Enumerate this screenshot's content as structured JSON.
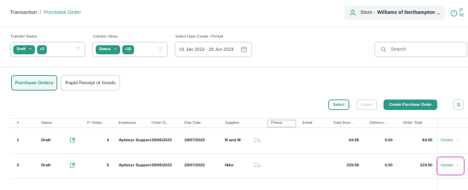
{
  "breadcrumb": {
    "root": "Transaction",
    "separator": "/",
    "current": "Purchase Order"
  },
  "store": {
    "prefix": "Store -",
    "name": "Williams of Northampton"
  },
  "help": {
    "label": "P M"
  },
  "filters": {
    "transfer_status": {
      "label": "Transfer Status",
      "chip": "Draft",
      "more": "+3"
    },
    "column_views": {
      "label": "Column Views",
      "chip": "Status",
      "more": "+10"
    },
    "date": {
      "label": "Select Date Create / Period",
      "value": "01 Jan 2023 - 29 Jun 2023"
    }
  },
  "search": {
    "placeholder": "Search"
  },
  "tabs": [
    {
      "label": "Purchase Orders",
      "active": true
    },
    {
      "label": "Rapid Receipt of Goods",
      "active": false
    }
  ],
  "actions": {
    "select": "Select",
    "export": "Export",
    "create": "Create Purchase Order",
    "sort": "⇅"
  },
  "table": {
    "columns": [
      "#",
      "Status",
      "P. Order...",
      "Employee",
      "Order D...",
      "Due Date",
      "Supplier",
      "Phone",
      "Email",
      "Total Item...",
      "Delivery ...",
      "Order Total"
    ],
    "rows": [
      {
        "num": "1",
        "status": "Draft",
        "po": "4",
        "employee": "Aptimyz Support",
        "order_date": "29/06/2023",
        "due_date": "29/07/2023",
        "supplier": "B and M",
        "phone": "",
        "email": "",
        "total_items": "64.95",
        "delivery": "0.00",
        "order_total": "64.95",
        "action": "Details"
      },
      {
        "num": "2",
        "status": "Draft",
        "po": "5",
        "employee": "Aptimyz Support",
        "order_date": "29/06/2023",
        "due_date": "29/07/2023",
        "supplier": "Nike",
        "phone": "",
        "email": "",
        "total_items": "229.90",
        "delivery": "0.00",
        "order_total": "229.90",
        "action": "Details"
      }
    ]
  },
  "colors": {
    "accent": "#2c9a86",
    "highlight": "#e03fd8"
  }
}
